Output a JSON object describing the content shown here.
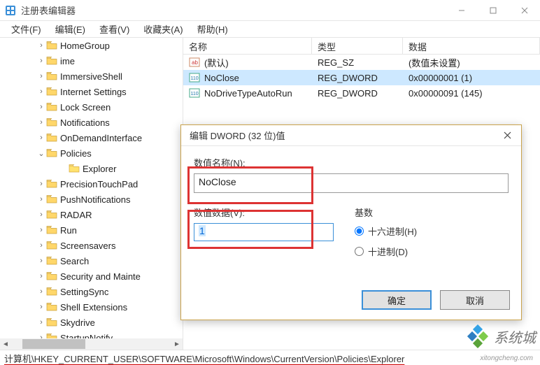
{
  "title": "注册表编辑器",
  "window_controls": {
    "min": "min",
    "max": "max",
    "close": "close"
  },
  "menu": {
    "file": "文件(F)",
    "edit": "编辑(E)",
    "view": "查看(V)",
    "fav": "收藏夹(A)",
    "help": "帮助(H)"
  },
  "tree": {
    "items": [
      {
        "label": "HomeGroup",
        "twisty": ">"
      },
      {
        "label": "ime",
        "twisty": ">"
      },
      {
        "label": "ImmersiveShell",
        "twisty": ">"
      },
      {
        "label": "Internet Settings",
        "twisty": ">"
      },
      {
        "label": "Lock Screen",
        "twisty": ">"
      },
      {
        "label": "Notifications",
        "twisty": ">"
      },
      {
        "label": "OnDemandInterface",
        "twisty": ">"
      },
      {
        "label": "Policies",
        "twisty": "v",
        "expanded": true
      },
      {
        "label": "PrecisionTouchPad",
        "twisty": ">"
      },
      {
        "label": "PushNotifications",
        "twisty": ">"
      },
      {
        "label": "RADAR",
        "twisty": ">"
      },
      {
        "label": "Run",
        "twisty": ">"
      },
      {
        "label": "Screensavers",
        "twisty": ">"
      },
      {
        "label": "Search",
        "twisty": ">"
      },
      {
        "label": "Security and Mainte",
        "twisty": ">"
      },
      {
        "label": "SettingSync",
        "twisty": ">"
      },
      {
        "label": "Shell Extensions",
        "twisty": ">"
      },
      {
        "label": "Skydrive",
        "twisty": ">"
      },
      {
        "label": "StartupNotify",
        "twisty": ">"
      }
    ],
    "child": {
      "label": "Explorer"
    }
  },
  "list": {
    "columns": {
      "name": "名称",
      "type": "类型",
      "data": "数据"
    },
    "rows": [
      {
        "name": "(默认)",
        "type": "REG_SZ",
        "data": "(数值未设置)",
        "kind": "string"
      },
      {
        "name": "NoClose",
        "type": "REG_DWORD",
        "data": "0x00000001 (1)",
        "kind": "dword",
        "selected": true
      },
      {
        "name": "NoDriveTypeAutoRun",
        "type": "REG_DWORD",
        "data": "0x00000091 (145)",
        "kind": "dword"
      }
    ]
  },
  "dialog": {
    "title": "编辑 DWORD (32 位)值",
    "name_label": "数值名称(N):",
    "name_value": "NoClose",
    "data_label": "数值数据(V):",
    "data_value": "1",
    "base_label": "基数",
    "hex_label": "十六进制(H)",
    "dec_label": "十进制(D)",
    "ok": "确定",
    "cancel": "取消"
  },
  "status_path": "计算机\\HKEY_CURRENT_USER\\SOFTWARE\\Microsoft\\Windows\\CurrentVersion\\Policies\\Explorer",
  "watermark": {
    "text": "系统城",
    "url": "xitongcheng.com"
  }
}
